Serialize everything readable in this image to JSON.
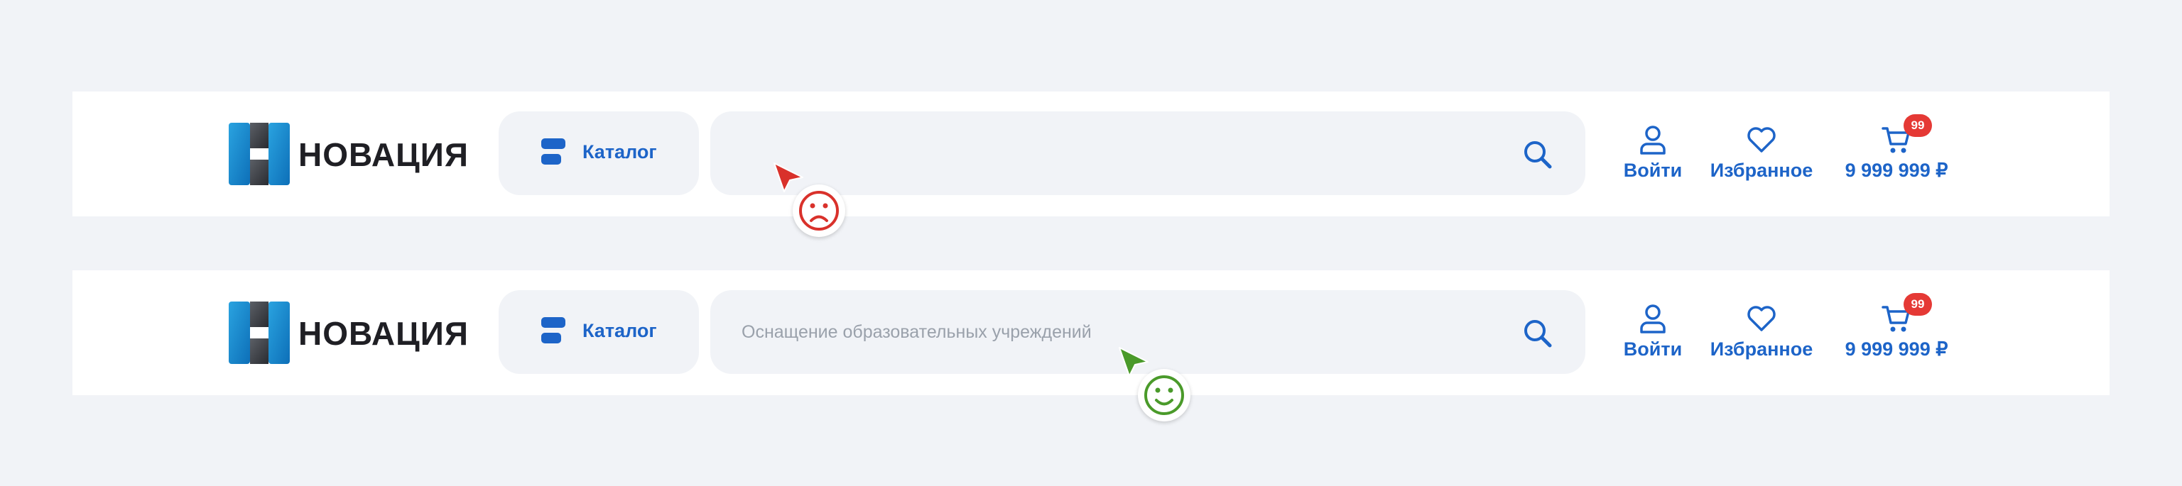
{
  "colors": {
    "accent": "#1d64c8",
    "badge": "#e53935",
    "bad": "#d9312b",
    "good": "#4a9a2a",
    "bar_bg": "#ffffff",
    "page_bg": "#f1f3f7"
  },
  "examples": [
    {
      "id": "bad",
      "logo_text": "НОВАЦИЯ",
      "catalog_label": "Каталог",
      "search": {
        "value": "",
        "placeholder": ""
      },
      "actions": {
        "login": "Войти",
        "favorites": "Избранное",
        "cart_total": "9 999 999 ₽",
        "cart_badge": "99"
      },
      "cursor_icon": "arrow-cursor-red",
      "emoji_icon": "sad-face-icon"
    },
    {
      "id": "good",
      "logo_text": "НОВАЦИЯ",
      "catalog_label": "Каталог",
      "search": {
        "value": "",
        "placeholder": "Оснащение образовательных учреждений"
      },
      "actions": {
        "login": "Войти",
        "favorites": "Избранное",
        "cart_total": "9 999 999 ₽",
        "cart_badge": "99"
      },
      "cursor_icon": "arrow-cursor-green",
      "emoji_icon": "happy-face-icon"
    }
  ]
}
